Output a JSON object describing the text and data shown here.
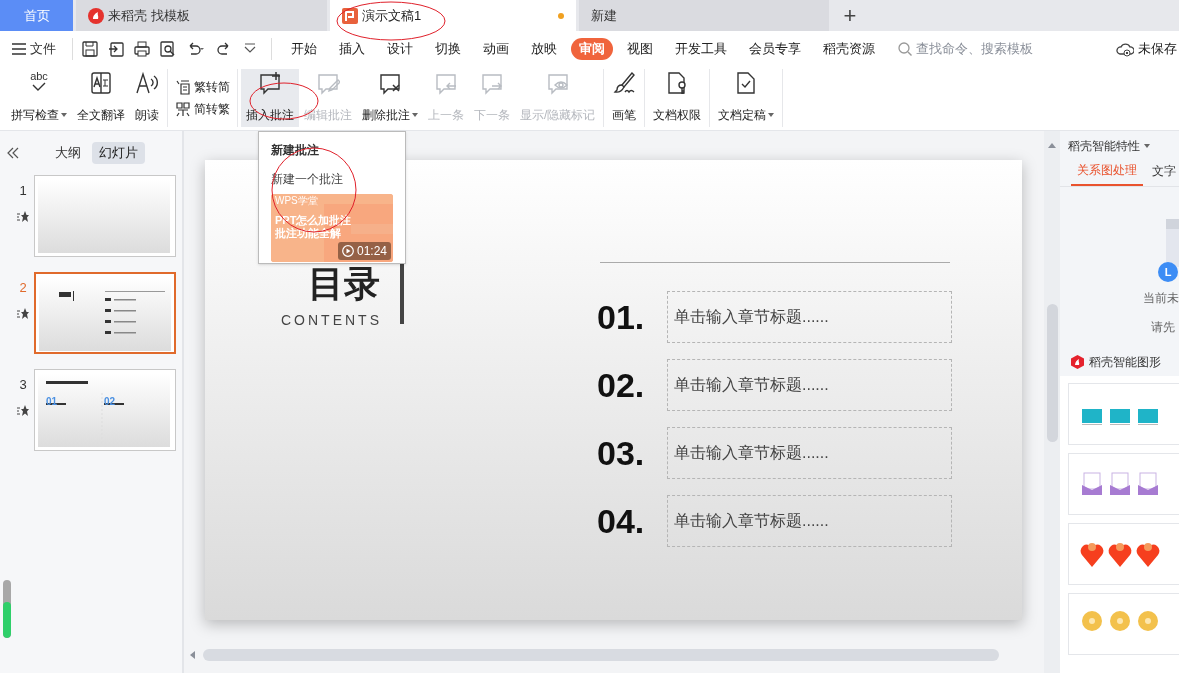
{
  "tabs": [
    {
      "label": "首页",
      "kind": "home",
      "selected": false
    },
    {
      "label": "来稻壳 找模板",
      "kind": "docer",
      "selected": false
    },
    {
      "label": "演示文稿1",
      "kind": "doc",
      "selected": true,
      "modified": true
    },
    {
      "label": "新建",
      "kind": "plain",
      "selected": false
    }
  ],
  "add_tab": "+",
  "menu": {
    "file": "文件",
    "tabs": [
      {
        "label": "开始",
        "selected": false
      },
      {
        "label": "插入",
        "selected": false
      },
      {
        "label": "设计",
        "selected": false
      },
      {
        "label": "切换",
        "selected": false
      },
      {
        "label": "动画",
        "selected": false
      },
      {
        "label": "放映",
        "selected": false
      },
      {
        "label": "审阅",
        "selected": true
      },
      {
        "label": "视图",
        "selected": false
      },
      {
        "label": "开发工具",
        "selected": false
      },
      {
        "label": "会员专享",
        "selected": false
      },
      {
        "label": "稻壳资源",
        "selected": false
      }
    ],
    "search": {
      "placeholder": "查找命令、搜索模板"
    },
    "save_status": "未保存"
  },
  "ribbon": [
    {
      "kind": "big",
      "icon_text": "abc",
      "label": "拼写检查",
      "dropdown": true,
      "disabled": false,
      "highlighted": false
    },
    {
      "kind": "big",
      "label": "全文翻译",
      "dropdown": false,
      "disabled": false,
      "highlighted": false
    },
    {
      "kind": "big",
      "label": "朗读",
      "dropdown": false,
      "disabled": false,
      "highlighted": false
    },
    {
      "kind": "pair",
      "items": [
        {
          "label": "繁转简"
        },
        {
          "label": "简转繁"
        }
      ]
    },
    {
      "kind": "big",
      "label": "插入批注",
      "dropdown": false,
      "disabled": false,
      "highlighted": true
    },
    {
      "kind": "big",
      "label": "编辑批注",
      "dropdown": false,
      "disabled": true,
      "highlighted": false
    },
    {
      "kind": "big",
      "label": "删除批注",
      "dropdown": true,
      "disabled": false,
      "highlighted": false
    },
    {
      "kind": "big",
      "label": "上一条",
      "dropdown": false,
      "disabled": true,
      "highlighted": false
    },
    {
      "kind": "big",
      "label": "下一条",
      "dropdown": false,
      "disabled": true,
      "highlighted": false
    },
    {
      "kind": "big",
      "label": "显示/隐藏标记",
      "dropdown": false,
      "disabled": true,
      "highlighted": false
    },
    {
      "kind": "big",
      "label": "画笔",
      "dropdown": false,
      "disabled": false,
      "highlighted": false
    },
    {
      "kind": "big",
      "label": "文档权限",
      "dropdown": false,
      "disabled": false,
      "highlighted": false
    },
    {
      "kind": "big",
      "label": "文档定稿",
      "dropdown": true,
      "disabled": false,
      "highlighted": false
    }
  ],
  "left_panel": {
    "views": [
      {
        "label": "大纲",
        "selected": false
      },
      {
        "label": "幻灯片",
        "selected": true
      }
    ],
    "slides": [
      {
        "number": "1",
        "selected": false
      },
      {
        "number": "2",
        "selected": true
      },
      {
        "number": "3",
        "selected": false,
        "labels": [
          "01",
          "02"
        ]
      }
    ],
    "meter": {
      "level": 0.62
    }
  },
  "popup": {
    "title": "新建批注",
    "item": "新建一个批注",
    "video": {
      "source": "WPS学堂",
      "title_lines": [
        "PPT怎么加批注",
        "批注功能全解"
      ],
      "duration": "01:24"
    }
  },
  "slide": {
    "title": "目录",
    "subtitle": "CONTENTS",
    "items": [
      {
        "number": "01.",
        "placeholder": "单击输入章节标题......"
      },
      {
        "number": "02.",
        "placeholder": "单击输入章节标题......"
      },
      {
        "number": "03.",
        "placeholder": "单击输入章节标题......"
      },
      {
        "number": "04.",
        "placeholder": "单击输入章节标题......"
      }
    ]
  },
  "right_panel": {
    "header": "稻壳智能特性",
    "tabs": [
      {
        "label": "关系图处理",
        "selected": true
      },
      {
        "label": "文字",
        "selected": false
      }
    ],
    "avatar": "L",
    "empty_lines": [
      "当前未",
      "请先"
    ],
    "section": "稻壳智能图形",
    "cards": [
      {
        "kind": "boxes"
      },
      {
        "kind": "envelopes"
      },
      {
        "kind": "hearts"
      },
      {
        "kind": "discs"
      }
    ]
  }
}
